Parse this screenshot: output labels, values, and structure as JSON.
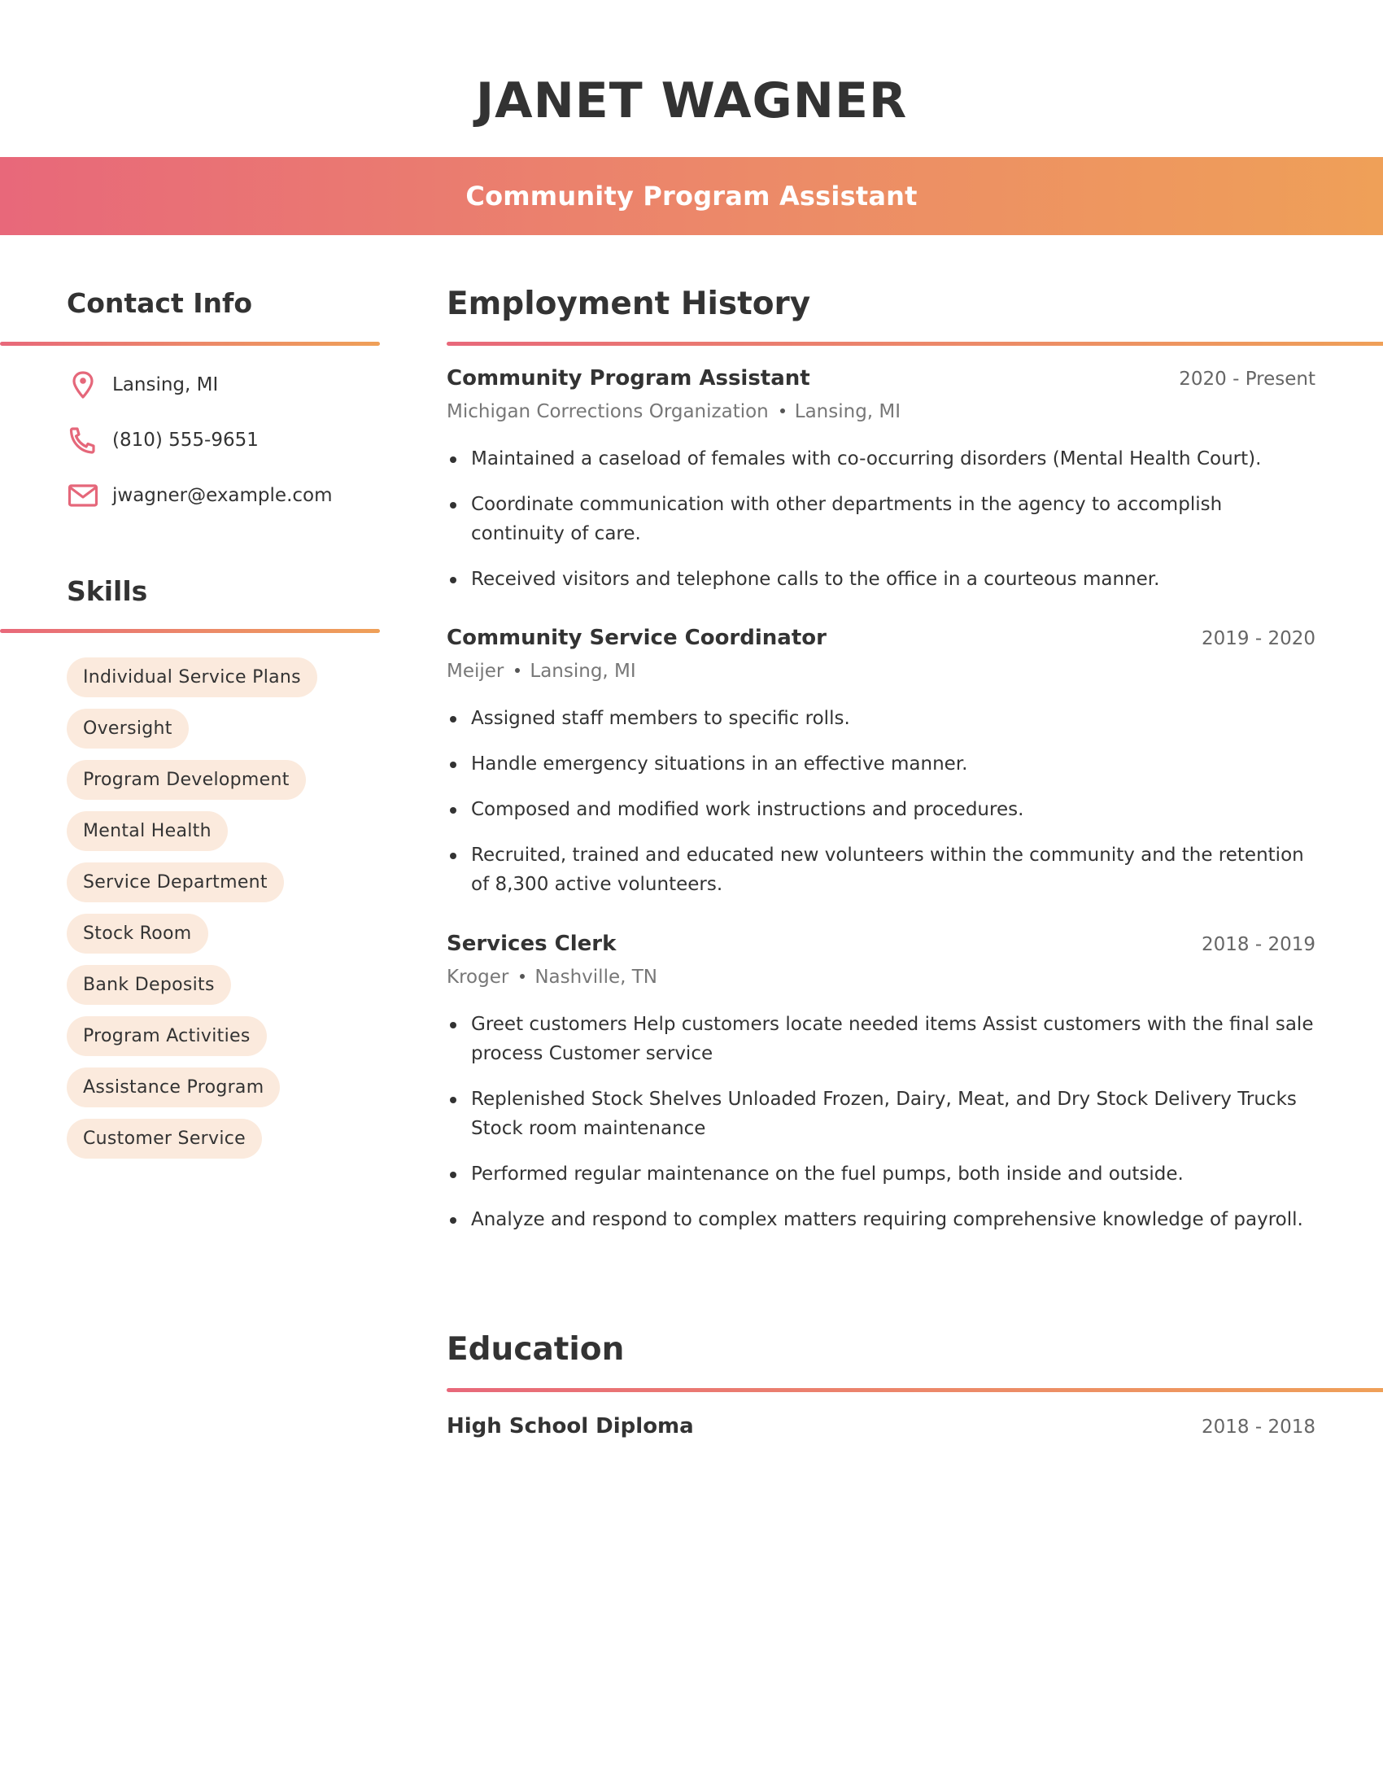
{
  "header": {
    "name": "JANET WAGNER",
    "title": "Community Program Assistant"
  },
  "colors": {
    "accent_start": "#e8687a",
    "accent_end": "#efa058",
    "pill_bg": "#fbeadd",
    "text": "#333333"
  },
  "contact": {
    "heading": "Contact Info",
    "items": [
      {
        "icon": "map-pin-icon",
        "text": "Lansing, MI"
      },
      {
        "icon": "phone-icon",
        "text": "(810) 555-9651"
      },
      {
        "icon": "mail-icon",
        "text": "jwagner@example.com"
      }
    ]
  },
  "skills": {
    "heading": "Skills",
    "items": [
      "Individual Service Plans",
      "Oversight",
      "Program Development",
      "Mental Health",
      "Service Department",
      "Stock Room",
      "Bank Deposits",
      "Program Activities",
      "Assistance Program",
      "Customer Service"
    ]
  },
  "employment": {
    "heading": "Employment History",
    "jobs": [
      {
        "title": "Community Program Assistant",
        "dates": "2020 - Present",
        "company": "Michigan Corrections Organization",
        "location": "Lansing, MI",
        "bullets": [
          "Maintained a caseload of females with co-occurring disorders (Mental Health Court).",
          "Coordinate communication with other departments in the agency to accomplish continuity of care.",
          "Received visitors and telephone calls to the office in a courteous manner."
        ]
      },
      {
        "title": "Community Service Coordinator",
        "dates": "2019 - 2020",
        "company": "Meijer",
        "location": "Lansing, MI",
        "bullets": [
          "Assigned staff members to specific rolls.",
          "Handle emergency situations in an effective manner.",
          "Composed and modified work instructions and procedures.",
          "Recruited, trained and educated new volunteers within the community and the retention of 8,300 active volunteers."
        ]
      },
      {
        "title": "Services Clerk",
        "dates": "2018 - 2019",
        "company": "Kroger",
        "location": "Nashville, TN",
        "bullets": [
          "Greet customers Help customers locate needed items Assist customers with the final sale process Customer service",
          "Replenished Stock Shelves Unloaded Frozen, Dairy, Meat, and Dry Stock Delivery Trucks Stock room maintenance",
          "Performed regular maintenance on the fuel pumps, both inside and outside.",
          "Analyze and respond to complex matters requiring comprehensive knowledge of payroll."
        ]
      }
    ]
  },
  "education": {
    "heading": "Education",
    "items": [
      {
        "degree": "High School Diploma",
        "dates": "2018 - 2018"
      }
    ]
  }
}
